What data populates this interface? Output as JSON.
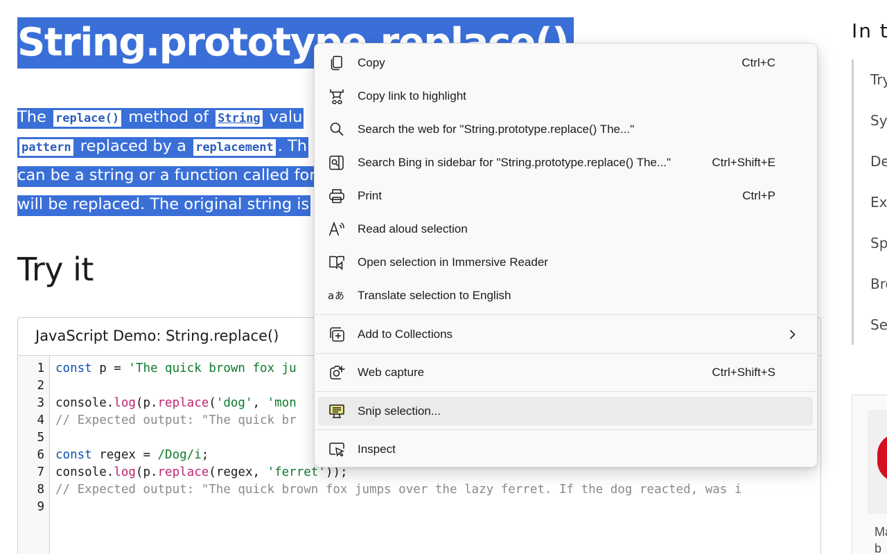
{
  "article": {
    "title": "String.prototype.replace()",
    "intro_lines": [
      [
        "The ",
        "replace()",
        " method of ",
        "String",
        " valu"
      ],
      [
        "pattern",
        " replaced by a ",
        "replacement",
        ". Th"
      ],
      [
        "can be a string or a function called for"
      ],
      [
        "will be replaced. The original string is"
      ]
    ],
    "try_it_heading": "Try it"
  },
  "demo": {
    "title": "JavaScript Demo: String.replace()",
    "line_numbers": [
      "1",
      "2",
      "3",
      "4",
      "5",
      "6",
      "7",
      "8",
      "9"
    ],
    "code": {
      "l1_kw": "const",
      "l1_rest": " p = ",
      "l1_str": "'The quick brown fox ju",
      "l3_a": "console.",
      "l3_fn1": "log",
      "l3_b": "(p.",
      "l3_fn2": "replace",
      "l3_c": "(",
      "l3_str1": "'dog'",
      "l3_d": ", ",
      "l3_str2": "'mon",
      "l4": "// Expected output: \"The quick br",
      "l6_kw": "const",
      "l6_rest": " regex = ",
      "l6_rx": "/Dog/i",
      "l6_end": ";",
      "l7_a": "console.",
      "l7_fn1": "log",
      "l7_b": "(p.",
      "l7_fn2": "replace",
      "l7_c": "(regex, ",
      "l7_str": "'ferret'",
      "l7_d": "));",
      "l8": "// Expected output: \"The quick brown fox jumps over the lazy ferret. If the dog reacted, was i"
    }
  },
  "toc": {
    "title": "In t",
    "items": [
      "Try",
      "Sy",
      "De",
      "Ex",
      "Sp",
      "Bro",
      "Se"
    ]
  },
  "ad": {
    "text1": "Ma",
    "text2": "b"
  },
  "context_menu": {
    "items": [
      {
        "label": "Copy",
        "shortcut": "Ctrl+C",
        "icon": "copy-icon"
      },
      {
        "label": "Copy link to highlight",
        "shortcut": "",
        "icon": "link-highlight-icon"
      },
      {
        "label": "Search the web for \"String.prototype.replace() The...\"",
        "shortcut": "",
        "icon": "search-icon"
      },
      {
        "label": "Search Bing in sidebar for \"String.prototype.replace() The...\"",
        "shortcut": "Ctrl+Shift+E",
        "icon": "sidebar-search-icon"
      },
      {
        "label": "Print",
        "shortcut": "Ctrl+P",
        "icon": "printer-icon"
      },
      {
        "label": "Read aloud selection",
        "shortcut": "",
        "icon": "read-aloud-icon"
      },
      {
        "label": "Open selection in Immersive Reader",
        "shortcut": "",
        "icon": "immersive-reader-icon"
      },
      {
        "label": "Translate selection to English",
        "shortcut": "",
        "icon": "translate-icon"
      },
      {
        "label": "Add to Collections",
        "shortcut": "",
        "icon": "collections-icon"
      },
      {
        "label": "Web capture",
        "shortcut": "Ctrl+Shift+S",
        "icon": "web-capture-icon"
      },
      {
        "label": "Snip selection...",
        "shortcut": "",
        "icon": "snip-icon"
      },
      {
        "label": "Inspect",
        "shortcut": "",
        "icon": "inspect-icon"
      }
    ]
  }
}
